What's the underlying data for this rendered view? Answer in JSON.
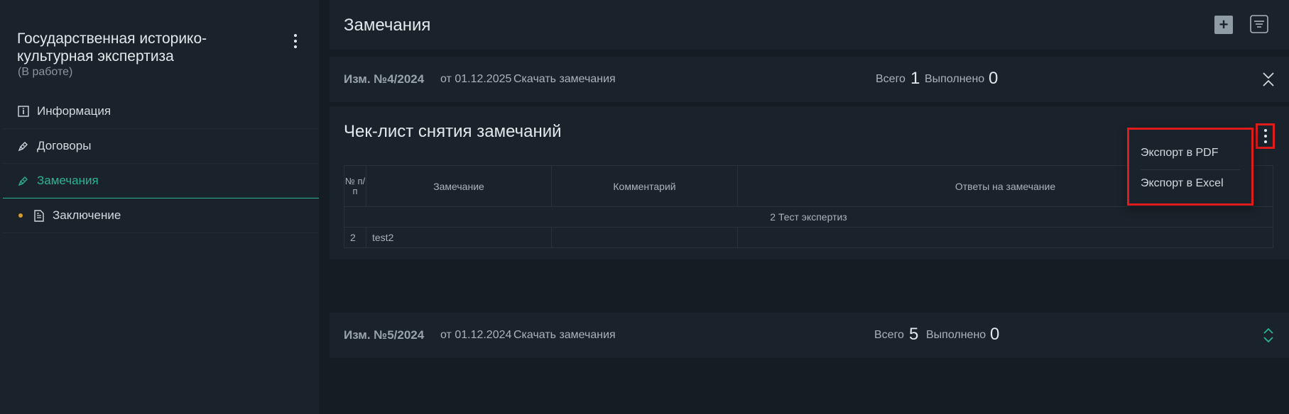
{
  "sidebar": {
    "project_title": "Государственная историко-культурная экспертиза",
    "project_status": "(В работе)",
    "items": [
      {
        "label": "Информация",
        "icon": "info-icon"
      },
      {
        "label": "Договоры",
        "icon": "pen-icon"
      },
      {
        "label": "Замечания",
        "icon": "pen-icon",
        "active": true
      },
      {
        "label": "Заключение",
        "icon": "document-icon",
        "marker": "orange-dot"
      }
    ]
  },
  "main": {
    "title": "Замечания",
    "revisions": [
      {
        "name": "Изм. №4/2024",
        "date": "от 01.12.2025",
        "download": "Скачать замечания",
        "total_label": "Всего",
        "total": "1",
        "done_label": "Выполнено",
        "done": "0",
        "expanded": true
      },
      {
        "name": "Изм. №5/2024",
        "date": "от 01.12.2024",
        "download": "Скачать замечания",
        "total_label": "Всего",
        "total": "5",
        "done_label": "Выполнено",
        "done": "0",
        "expanded": false
      }
    ],
    "checklist": {
      "title": "Чек-лист снятия замечаний",
      "columns": [
        "№ п/ п",
        "Замечание",
        "Комментарий",
        "Ответы на замечание"
      ],
      "group_row": "2 Тест экспертиз",
      "rows": [
        {
          "num": "2",
          "remark": "test2",
          "comment": "",
          "answers": ""
        }
      ]
    },
    "export_menu": {
      "items": [
        "Экспорт в PDF",
        "Экспорт в Excel"
      ]
    }
  },
  "colors": {
    "background": "#151d24",
    "panel": "#1a232b",
    "accent": "#2bb394",
    "highlight": "#e01b1b",
    "dot": "#d99a2b"
  }
}
